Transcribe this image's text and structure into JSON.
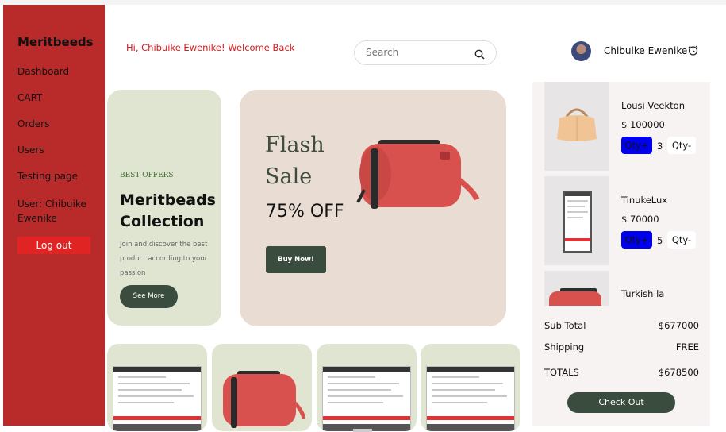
{
  "brand": "Meritbeeds",
  "nav": [
    {
      "label": "Dashboard"
    },
    {
      "label": "CART"
    },
    {
      "label": "Orders"
    },
    {
      "label": "Users"
    },
    {
      "label": "Testing page"
    },
    {
      "label": "User: Chibuike Ewenike"
    }
  ],
  "logout_label": "Log out",
  "greeting": "Hi, Chibuike Ewenike! Welcome Back",
  "search": {
    "placeholder": "Search"
  },
  "user": {
    "name": "Chibuike Ewenike"
  },
  "offer": {
    "kicker": "BEST OFFERS",
    "title": "Meritbeads Collection",
    "description": "Join and discover the best product according to your passion",
    "button": "See More"
  },
  "flash": {
    "title": "Flash Sale",
    "discount": "75% OFF",
    "button": "Buy Now!"
  },
  "cart": {
    "items": [
      {
        "name": "Lousi Veekton",
        "price": "$ 100000",
        "qty_plus": "Qty+",
        "qty": "3",
        "qty_minus": "Qty-"
      },
      {
        "name": "TinukeLux",
        "price": "$ 70000",
        "qty_plus": "Qty+",
        "qty": "5",
        "qty_minus": "Qty-"
      },
      {
        "name": "Turkish la"
      }
    ],
    "subtotal_label": "Sub Total",
    "subtotal": "$677000",
    "shipping_label": "Shipping",
    "shipping": "FREE",
    "totals_label": "TOTALS",
    "totals": "$678500",
    "checkout": "Check Out"
  },
  "colors": {
    "sidebar": "#b92b2b",
    "accent_red": "#d11c1c",
    "dark_green": "#3a4c3e",
    "qty_blue": "#0000ee"
  }
}
